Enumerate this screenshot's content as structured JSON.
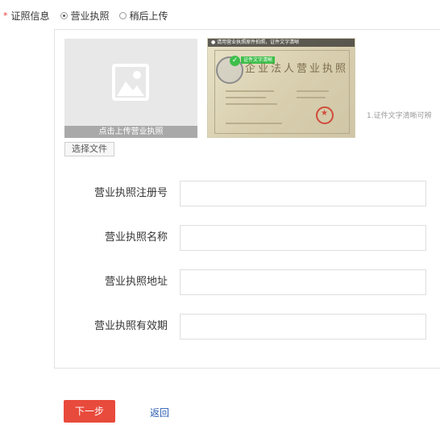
{
  "license_field": {
    "required_mark": "*",
    "label": "证照信息",
    "options": [
      {
        "label": "营业执照",
        "checked": true
      },
      {
        "label": "稍后上传",
        "checked": false
      }
    ]
  },
  "upload": {
    "icon": "image-placeholder-icon",
    "caption": "点击上传营业执照",
    "choose_file_label": "选择文件"
  },
  "sample": {
    "banner": "● 请用营业执照原件拍照，证件文字清晰",
    "badge": "证件文字清晰",
    "title": "企业法人营业执照"
  },
  "hint": "1.证件文字清晰可辨",
  "form": {
    "reg_number": {
      "label": "营业执照注册号",
      "value": ""
    },
    "name": {
      "label": "营业执照名称",
      "value": ""
    },
    "address": {
      "label": "营业执照地址",
      "value": ""
    },
    "validity": {
      "label": "营业执照有效期",
      "value": ""
    }
  },
  "actions": {
    "next_label": "下一步",
    "back_label": "返回"
  },
  "colors": {
    "required": "#e4393c",
    "primary_button": "#e84a3c",
    "link": "#2a5db0"
  }
}
